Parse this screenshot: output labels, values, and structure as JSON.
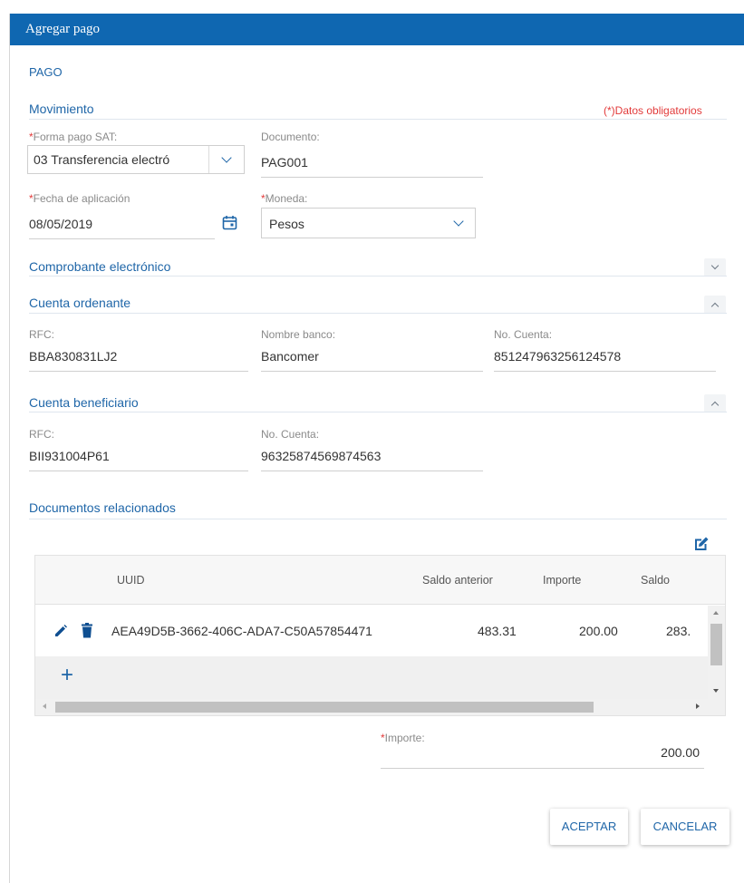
{
  "dialog": {
    "title": "Agregar pago"
  },
  "section_pago": "PAGO",
  "movimiento": {
    "title": "Movimiento",
    "required_note": "(*)Datos obligatorios",
    "forma_pago": {
      "label": "Forma pago SAT:",
      "value": "03 Transferencia electró"
    },
    "documento": {
      "label": "Documento:",
      "value": "PAG001"
    },
    "fecha": {
      "label": "Fecha de aplicación",
      "value": "08/05/2019"
    },
    "moneda": {
      "label": "Moneda:",
      "value": "Pesos"
    }
  },
  "comprobante": {
    "title": "Comprobante electrónico"
  },
  "cuenta_ordenante": {
    "title": "Cuenta ordenante",
    "rfc": {
      "label": "RFC:",
      "value": "BBA830831LJ2"
    },
    "banco": {
      "label": "Nombre banco:",
      "value": "Bancomer"
    },
    "cuenta": {
      "label": "No. Cuenta:",
      "value": "851247963256124578"
    }
  },
  "cuenta_beneficiario": {
    "title": "Cuenta beneficiario",
    "rfc": {
      "label": "RFC:",
      "value": "BII931004P61"
    },
    "cuenta": {
      "label": "No. Cuenta:",
      "value": "96325874569874563"
    }
  },
  "documentos": {
    "title": "Documentos relacionados",
    "columns": [
      "UUID",
      "Saldo anterior",
      "Importe",
      "Saldo"
    ],
    "rows": [
      {
        "uuid": "AEA49D5B-3662-406C-ADA7-C50A57854471",
        "saldo_anterior": "483.31",
        "importe": "200.00",
        "saldo": "283."
      }
    ],
    "add_symbol": "+"
  },
  "importe": {
    "label": "Importe:",
    "value": "200.00"
  },
  "buttons": {
    "accept": "ACEPTAR",
    "cancel": "CANCELAR"
  },
  "colors": {
    "titlebar": "#0f67b1",
    "accent": "#1f66a8",
    "required": "#e23a3a"
  }
}
